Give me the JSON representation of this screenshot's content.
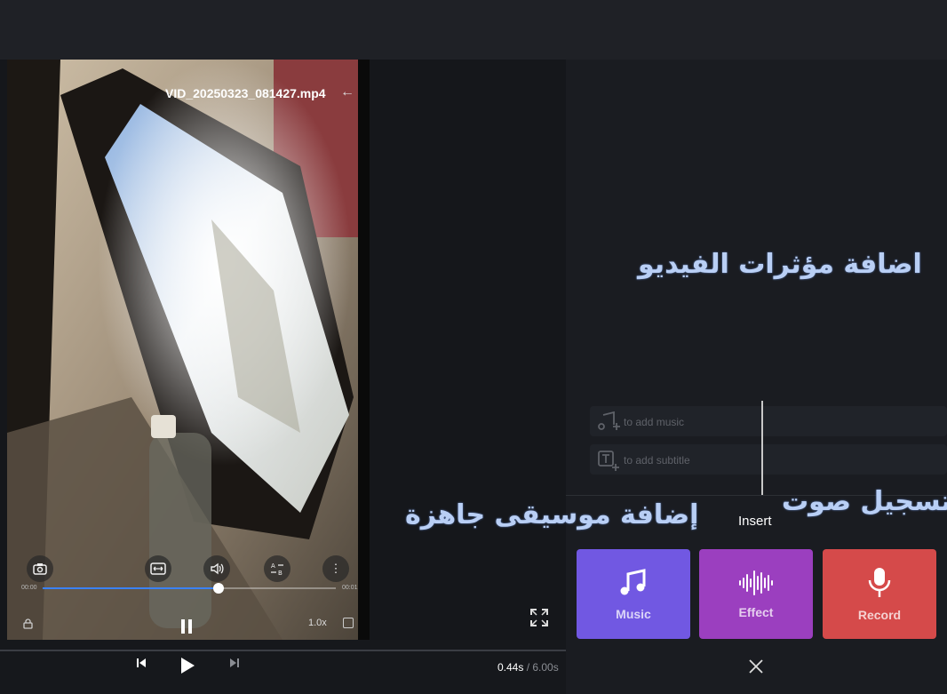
{
  "player": {
    "filename": "VID_20250323_081427.mp4",
    "time_start": "00:00",
    "time_end": "00:01",
    "speed": "1.0x",
    "progress_fraction": 0.6
  },
  "playback": {
    "current_time": "0.44s",
    "total_time": "/ 6.00s"
  },
  "annotations": {
    "video_effects": "اضافة مؤثرات الفيديو",
    "ready_music": "إضافة موسيقى جاهزة",
    "record_voice": "تسجيل صوت"
  },
  "timeline": {
    "add_music": "to add music",
    "add_subtitle": "to add subtitle"
  },
  "insert": {
    "title": "Insert",
    "tiles": [
      {
        "label": "Music",
        "icon": "music-note-icon",
        "color": "#7158e2"
      },
      {
        "label": "Effect",
        "icon": "sound-wave-icon",
        "color": "#9b3fbf"
      },
      {
        "label": "Record",
        "icon": "microphone-icon",
        "color": "#d54a4a"
      }
    ]
  },
  "colors": {
    "accent_blue": "#3b82f6",
    "annotation": "#b9cff5"
  }
}
